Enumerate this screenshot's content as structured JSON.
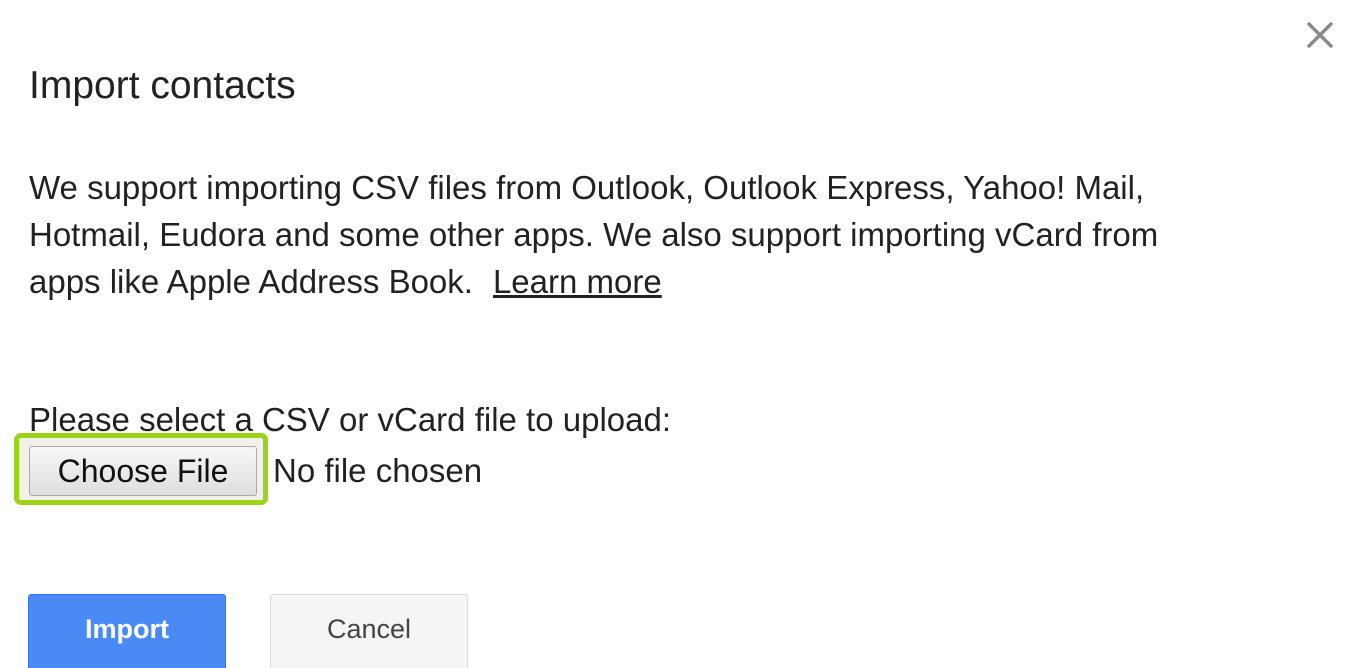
{
  "dialog": {
    "title": "Import contacts",
    "close_icon": "close-icon",
    "description": {
      "line1": "We support importing CSV files from Outlook, Outlook Express, Yahoo! Mail,",
      "line2": "Hotmail, Eudora and some other apps. We also support importing vCard from",
      "line3": "apps like Apple Address Book.",
      "learn_more_label": "Learn more"
    },
    "upload": {
      "label": "Please select a CSV or vCard file to upload:",
      "choose_file_label": "Choose File",
      "file_status": "No file chosen",
      "highlight_color": "#9ad31a"
    },
    "actions": {
      "import_label": "Import",
      "cancel_label": "Cancel",
      "import_color": "#4a8af4"
    }
  }
}
